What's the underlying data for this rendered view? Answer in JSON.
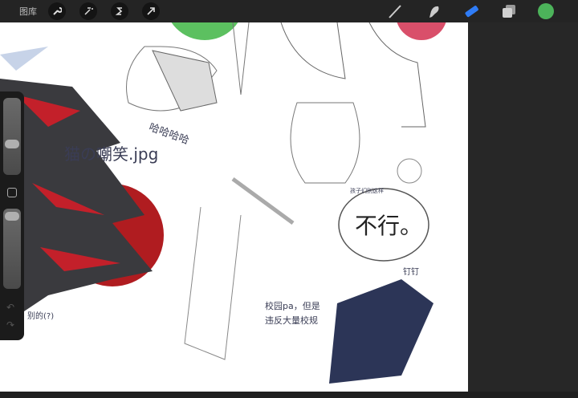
{
  "topbar": {
    "gallery_label": "图库",
    "tools_left": [
      "wrench-icon",
      "magic-wand-icon",
      "selection-icon",
      "transform-arrow-icon"
    ],
    "tools_right": [
      "brush-icon",
      "smudge-icon",
      "eraser-icon",
      "layers-icon",
      "color-icon"
    ],
    "active_tool": "eraser",
    "accent": "#2f7cf6",
    "current_color": "#4cb35a"
  },
  "sidebar": {
    "undo": "↶",
    "redo": "↷"
  },
  "artwork_text": {
    "cat_caption": "猫の嘲笑.jpg",
    "haha": "哈哈哈哈",
    "no": "不行。",
    "campus": "校园pa，但是违反大量校规",
    "small_bubble": "孩子们别这样",
    "note": "别的(?)",
    "nail": "钉钉"
  }
}
